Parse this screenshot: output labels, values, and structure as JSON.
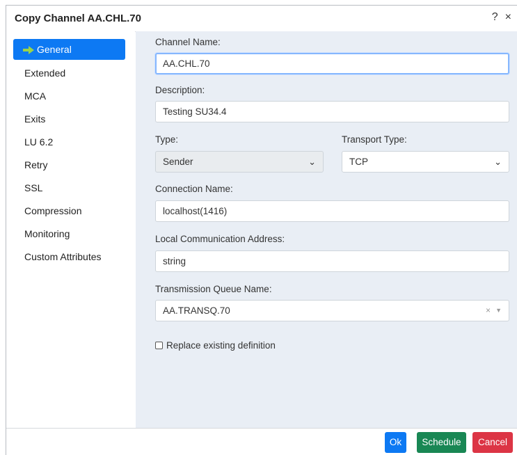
{
  "dialog": {
    "title": "Copy Channel AA.CHL.70",
    "help_label": "?",
    "close_label": "×"
  },
  "sidebar": {
    "items": [
      {
        "label": "General"
      },
      {
        "label": "Extended"
      },
      {
        "label": "MCA"
      },
      {
        "label": "Exits"
      },
      {
        "label": "LU 6.2"
      },
      {
        "label": "Retry"
      },
      {
        "label": "SSL"
      },
      {
        "label": "Compression"
      },
      {
        "label": "Monitoring"
      },
      {
        "label": "Custom Attributes"
      }
    ],
    "active_index": 0
  },
  "form": {
    "channel_name": {
      "label": "Channel Name:",
      "value": "AA.CHL.70"
    },
    "description": {
      "label": "Description:",
      "value": "Testing SU34.4"
    },
    "type": {
      "label": "Type:",
      "value": "Sender"
    },
    "transport_type": {
      "label": "Transport Type:",
      "value": "TCP"
    },
    "connection_name": {
      "label": "Connection Name:",
      "value": "localhost(1416)"
    },
    "local_address": {
      "label": "Local Communication Address:",
      "value": "string"
    },
    "xmit_queue": {
      "label": "Transmission Queue Name:",
      "value": "AA.TRANSQ.70"
    },
    "replace_existing": {
      "label": "Replace existing definition",
      "checked": false
    }
  },
  "footer": {
    "ok_label": "Ok",
    "schedule_label": "Schedule",
    "cancel_label": "Cancel"
  },
  "colors": {
    "primary": "#0d79f3",
    "success": "#198754",
    "danger": "#dc3545",
    "content_bg": "#e9eef5"
  }
}
